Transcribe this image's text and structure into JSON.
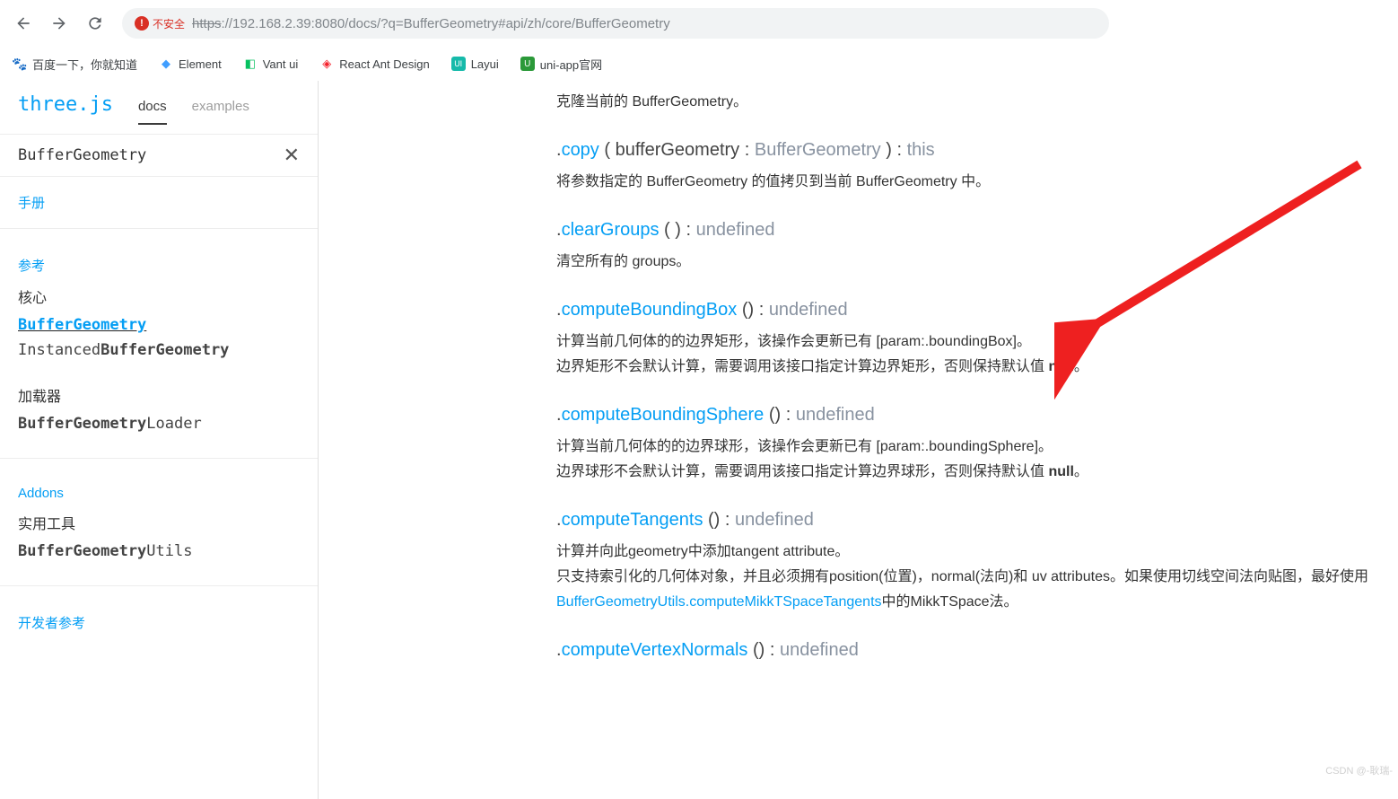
{
  "browser": {
    "insecure_label": "不安全",
    "url_proto_strike": "https",
    "url_rest": "://192.168.2.39:8080/docs/?q=BufferGeometry#api/zh/core/BufferGeometry"
  },
  "bookmarks": [
    {
      "label": "百度一下，你就知道"
    },
    {
      "label": "Element"
    },
    {
      "label": "Vant ui"
    },
    {
      "label": "React Ant Design"
    },
    {
      "label": "Layui"
    },
    {
      "label": "uni-app官网"
    }
  ],
  "sidebar": {
    "logo": "three.js",
    "tab_docs": "docs",
    "tab_examples": "examples",
    "search_value": "BufferGeometry",
    "link_manual": "手册",
    "link_ref": "参考",
    "cat_core": "核心",
    "item_buffergeom": "BufferGeometry",
    "item_instanced_prefix": "Instanced",
    "item_instanced_match": "BufferGeometry",
    "cat_loader": "加载器",
    "item_loader_match": "BufferGeometry",
    "item_loader_suffix": "Loader",
    "link_addons": "Addons",
    "cat_util": "实用工具",
    "item_utils_match": "BufferGeometry",
    "item_utils_suffix": "Utils",
    "link_dev": "开发者参考"
  },
  "content": {
    "m0_desc": "克隆当前的 BufferGeometry。",
    "m1_name": "copy",
    "m1_sig_open": " ( ",
    "m1_param": "bufferGeometry : ",
    "m1_ptype": "BufferGeometry",
    "m1_sig_close": " ) : ",
    "m1_ret": "this",
    "m1_desc": "将参数指定的 BufferGeometry 的值拷贝到当前 BufferGeometry 中。",
    "m2_name": "clearGroups",
    "m2_sig": " ( ) : ",
    "m2_ret": "undefined",
    "m2_desc": "清空所有的 groups。",
    "m3_name": "computeBoundingBox",
    "m3_sig": " () : ",
    "m3_ret": "undefined",
    "m3_desc1": "计算当前几何体的的边界矩形，该操作会更新已有 [param:.boundingBox]。",
    "m3_desc2a": "边界矩形不会默认计算，需要调用该接口指定计算边界矩形，否则保持默认值 ",
    "m3_desc2b": "null",
    "m3_desc2c": "。",
    "m4_name": "computeBoundingSphere",
    "m4_sig": " () : ",
    "m4_ret": "undefined",
    "m4_desc1": "计算当前几何体的的边界球形，该操作会更新已有 [param:.boundingSphere]。",
    "m4_desc2a": "边界球形不会默认计算，需要调用该接口指定计算边界球形，否则保持默认值 ",
    "m4_desc2b": "null",
    "m4_desc2c": "。",
    "m5_name": "computeTangents",
    "m5_sig": " () : ",
    "m5_ret": "undefined",
    "m5_desc1": "计算并向此geometry中添加tangent attribute。",
    "m5_desc2a": "只支持索引化的几何体对象，并且必须拥有position(位置)，normal(法向)和 uv attributes。如果使用切线空间法向贴图，最好使用",
    "m5_desc2link": "BufferGeometryUtils.computeMikkTSpaceTangents",
    "m5_desc2b": "中的MikkTSpace法。",
    "m6_name": "computeVertexNormals",
    "m6_sig": " () : ",
    "m6_ret": "undefined"
  },
  "watermark": "CSDN @-耿瑞-"
}
